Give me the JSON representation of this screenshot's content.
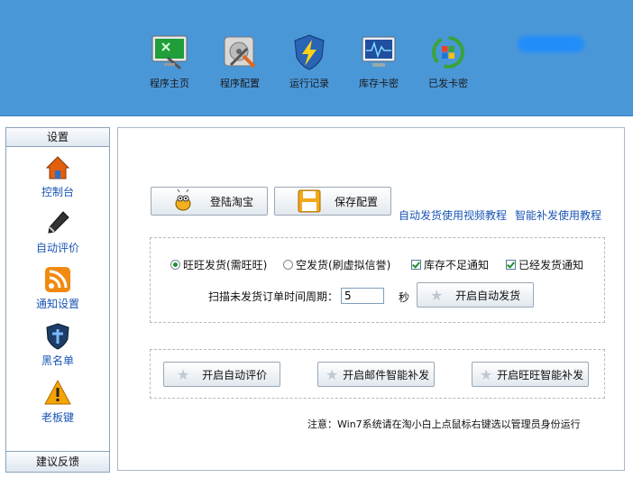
{
  "toolbar": {
    "items": [
      {
        "label": "程序主页",
        "icon": "monitor-icon"
      },
      {
        "label": "程序配置",
        "icon": "disk-tools-icon"
      },
      {
        "label": "运行记录",
        "icon": "shield-lightning-icon"
      },
      {
        "label": "库存卡密",
        "icon": "monitor-chart-icon"
      },
      {
        "label": "已发卡密",
        "icon": "refresh-windows-icon"
      }
    ]
  },
  "sidebar": {
    "header": "设置",
    "items": [
      {
        "label": "控制台",
        "icon": "home-icon"
      },
      {
        "label": "自动评价",
        "icon": "pen-icon"
      },
      {
        "label": "通知设置",
        "icon": "rss-icon"
      },
      {
        "label": "黑名单",
        "icon": "shield-icon"
      },
      {
        "label": "老板键",
        "icon": "warning-icon"
      }
    ],
    "footer": "建议反馈"
  },
  "main": {
    "login_button": "登陆淘宝",
    "save_button": "保存配置",
    "link_video_auto": "自动发货使用视频教程",
    "link_video_smart": "智能补发使用教程",
    "options": {
      "wangwang": "旺旺发货(需旺旺)",
      "empty": "空发货(刷虚拟信誉)",
      "stock_notify": "库存不足通知",
      "sent_notify": "已经发货通知",
      "selected_mode": "旺旺发货(需旺旺)",
      "stock_notify_checked": true,
      "sent_notify_checked": true
    },
    "scan_label": "扫描未发货订单时间周期：",
    "scan_value": "5",
    "scan_unit": "秒",
    "auto_ship_button": "开启自动发货",
    "auto_review_button": "开启自动评价",
    "mail_resend_button": "开启邮件智能补发",
    "wangwang_resend_button": "开启旺旺智能补发",
    "note": "注意：Win7系统请在淘小白上点鼠标右键选以管理员身份运行"
  }
}
